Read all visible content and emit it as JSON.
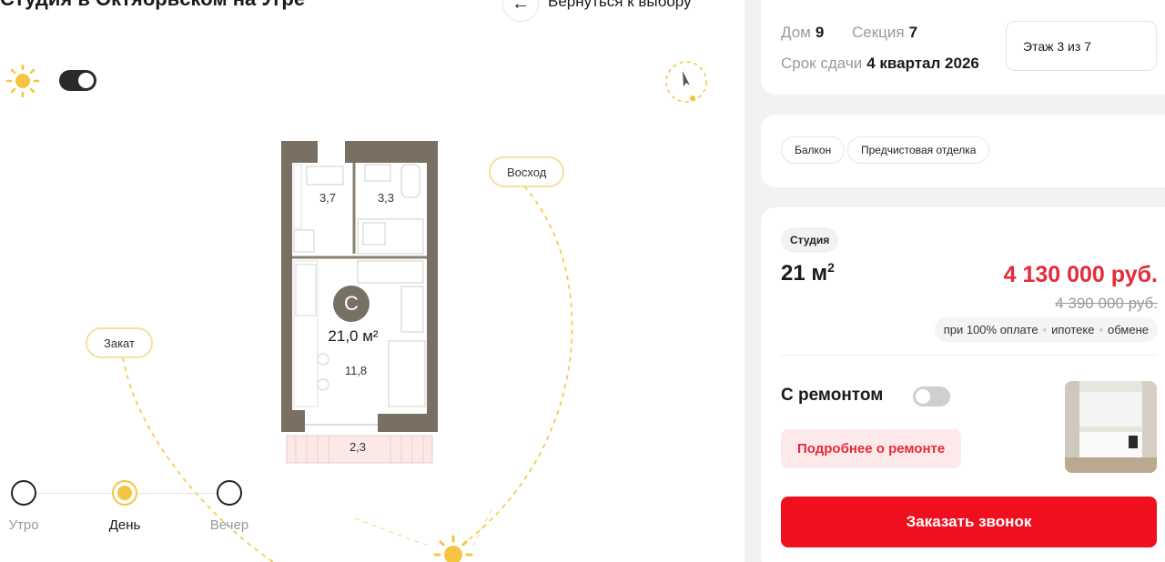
{
  "header": {
    "title": "Студия в Октябрьском на Угре",
    "back_label": "Вернуться к выбору"
  },
  "sunlight": {
    "sunrise_label": "Восход",
    "sunset_label": "Закат",
    "times": [
      {
        "label": "Утро",
        "active": false
      },
      {
        "label": "День",
        "active": true
      },
      {
        "label": "Вечер",
        "active": false
      }
    ],
    "accent_color": "#f5c542"
  },
  "plan": {
    "type_letter": "C",
    "area_label": "21,0 м²",
    "rooms": {
      "bath": "3,7",
      "kitchen_top": "3,3",
      "main": "11,8",
      "balcony": "2,3"
    }
  },
  "details": {
    "house_label": "Дом",
    "house_value": "9",
    "section_label": "Секция",
    "section_value": "7",
    "deadline_label": "Срок сдачи",
    "deadline_value": "4 квартал 2026",
    "floor": "Этаж 3 из 7"
  },
  "tags": [
    "Балкон",
    "Предчистовая отделка"
  ],
  "offer": {
    "type": "Студия",
    "area": "21 м",
    "area_sup": "2",
    "price": "4 130 000 руб.",
    "old_price": "4 390 000 руб.",
    "conditions": [
      "при 100% оплате",
      "ипотеке",
      "обмене"
    ],
    "repair_label": "С ремонтом",
    "repair_more": "Подробнее о ремонте",
    "callback": "Заказать звонок"
  },
  "colors": {
    "price_red": "#e52a3a",
    "button_red": "#ef0f1f"
  }
}
